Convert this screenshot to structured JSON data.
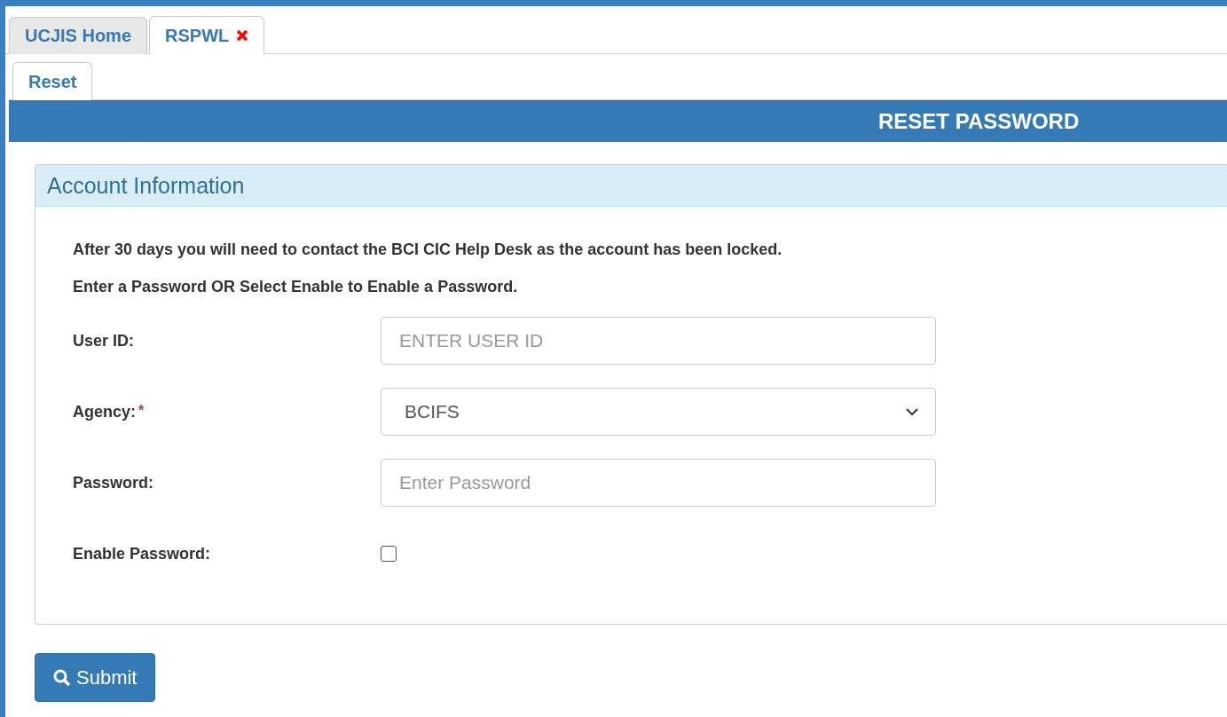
{
  "tabs": [
    {
      "label": "UCJIS Home",
      "selected": false,
      "closable": false
    },
    {
      "label": "RSPWL",
      "selected": true,
      "closable": true
    }
  ],
  "subtabs": [
    {
      "label": "Reset",
      "selected": true
    }
  ],
  "header": {
    "title": "RESET PASSWORD"
  },
  "panel": {
    "title": "Account Information",
    "notes": [
      "After 30 days you will need to contact the BCI CIC Help Desk as the account has been locked.",
      "Enter a Password OR Select Enable to Enable a Password."
    ],
    "fields": [
      {
        "kind": "text",
        "label": "User ID:",
        "placeholder": "ENTER USER ID"
      },
      {
        "kind": "select",
        "label": "Agency:",
        "required_mark": "*",
        "value": "BCIFS"
      },
      {
        "kind": "text",
        "label": "Password:",
        "placeholder": "Enter Password"
      },
      {
        "kind": "checkbox",
        "label": "Enable Password:",
        "checked": false
      }
    ]
  },
  "submit": {
    "label": "Submit"
  }
}
